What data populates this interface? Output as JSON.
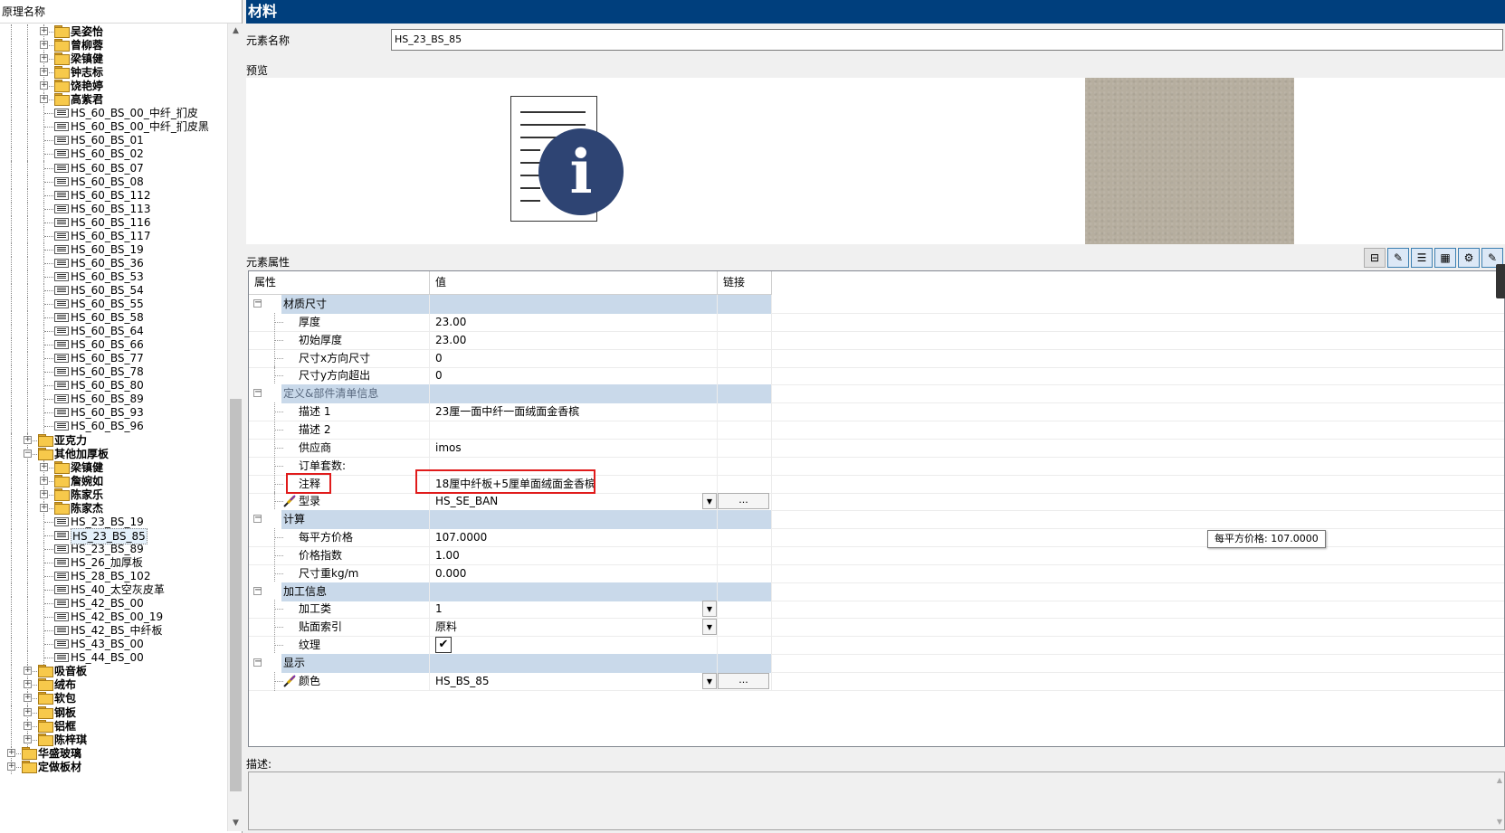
{
  "left_panel": {
    "header": "原理名称",
    "tree": [
      {
        "label": "吴姿怡",
        "type": "folder",
        "level": 2,
        "expanded": false
      },
      {
        "label": "曾柳蓉",
        "type": "folder",
        "level": 2,
        "expanded": false
      },
      {
        "label": "梁镇健",
        "type": "folder",
        "level": 2,
        "expanded": false
      },
      {
        "label": "钟志标",
        "type": "folder",
        "level": 2,
        "expanded": false
      },
      {
        "label": "饶艳婷",
        "type": "folder",
        "level": 2,
        "expanded": false
      },
      {
        "label": "高紫君",
        "type": "folder",
        "level": 2,
        "expanded": false
      },
      {
        "label": "HS_60_BS_00_中纤_扪皮",
        "type": "material",
        "level": 2
      },
      {
        "label": "HS_60_BS_00_中纤_扪皮黑",
        "type": "material",
        "level": 2
      },
      {
        "label": "HS_60_BS_01",
        "type": "material",
        "level": 2
      },
      {
        "label": "HS_60_BS_02",
        "type": "material",
        "level": 2
      },
      {
        "label": "HS_60_BS_07",
        "type": "material",
        "level": 2
      },
      {
        "label": "HS_60_BS_08",
        "type": "material",
        "level": 2
      },
      {
        "label": "HS_60_BS_112",
        "type": "material",
        "level": 2
      },
      {
        "label": "HS_60_BS_113",
        "type": "material",
        "level": 2
      },
      {
        "label": "HS_60_BS_116",
        "type": "material",
        "level": 2
      },
      {
        "label": "HS_60_BS_117",
        "type": "material",
        "level": 2
      },
      {
        "label": "HS_60_BS_19",
        "type": "material",
        "level": 2
      },
      {
        "label": "HS_60_BS_36",
        "type": "material",
        "level": 2
      },
      {
        "label": "HS_60_BS_53",
        "type": "material",
        "level": 2
      },
      {
        "label": "HS_60_BS_54",
        "type": "material",
        "level": 2
      },
      {
        "label": "HS_60_BS_55",
        "type": "material",
        "level": 2
      },
      {
        "label": "HS_60_BS_58",
        "type": "material",
        "level": 2
      },
      {
        "label": "HS_60_BS_64",
        "type": "material",
        "level": 2
      },
      {
        "label": "HS_60_BS_66",
        "type": "material",
        "level": 2
      },
      {
        "label": "HS_60_BS_77",
        "type": "material",
        "level": 2
      },
      {
        "label": "HS_60_BS_78",
        "type": "material",
        "level": 2
      },
      {
        "label": "HS_60_BS_80",
        "type": "material",
        "level": 2
      },
      {
        "label": "HS_60_BS_89",
        "type": "material",
        "level": 2
      },
      {
        "label": "HS_60_BS_93",
        "type": "material",
        "level": 2
      },
      {
        "label": "HS_60_BS_96",
        "type": "material",
        "level": 2
      },
      {
        "label": "亚克力",
        "type": "folder",
        "level": 1,
        "expanded": false
      },
      {
        "label": "其他加厚板",
        "type": "folder",
        "level": 1,
        "expanded": true
      },
      {
        "label": "梁镇健",
        "type": "folder",
        "level": 2,
        "expanded": false
      },
      {
        "label": "詹婉如",
        "type": "folder",
        "level": 2,
        "expanded": false
      },
      {
        "label": "陈家乐",
        "type": "folder",
        "level": 2,
        "expanded": false
      },
      {
        "label": "陈家杰",
        "type": "folder",
        "level": 2,
        "expanded": false
      },
      {
        "label": "HS_23_BS_19",
        "type": "material",
        "level": 2
      },
      {
        "label": "HS_23_BS_85",
        "type": "material",
        "level": 2,
        "selected": true
      },
      {
        "label": "HS_23_BS_89",
        "type": "material",
        "level": 2
      },
      {
        "label": "HS_26_加厚板",
        "type": "material",
        "level": 2
      },
      {
        "label": "HS_28_BS_102",
        "type": "material",
        "level": 2
      },
      {
        "label": "HS_40_太空灰皮革",
        "type": "material",
        "level": 2
      },
      {
        "label": "HS_42_BS_00",
        "type": "material",
        "level": 2
      },
      {
        "label": "HS_42_BS_00_19",
        "type": "material",
        "level": 2
      },
      {
        "label": "HS_42_BS_中纤板",
        "type": "material",
        "level": 2
      },
      {
        "label": "HS_43_BS_00",
        "type": "material",
        "level": 2
      },
      {
        "label": "HS_44_BS_00",
        "type": "material",
        "level": 2
      },
      {
        "label": "吸音板",
        "type": "folder",
        "level": 1,
        "expanded": false
      },
      {
        "label": "绒布",
        "type": "folder",
        "level": 1,
        "expanded": false
      },
      {
        "label": "软包",
        "type": "folder",
        "level": 1,
        "expanded": false
      },
      {
        "label": "钢板",
        "type": "folder",
        "level": 1,
        "expanded": false
      },
      {
        "label": "铝框",
        "type": "folder",
        "level": 1,
        "expanded": false
      },
      {
        "label": "陈梓琪",
        "type": "folder",
        "level": 1,
        "expanded": false
      },
      {
        "label": "华盛玻璃",
        "type": "folder",
        "level": 0,
        "expanded": false
      },
      {
        "label": "定做板材",
        "type": "folder",
        "level": 0,
        "expanded": false
      }
    ]
  },
  "right_panel": {
    "title": "材料",
    "element_name_label": "元素名称",
    "element_name_value": "HS_23_BS_85",
    "preview_label": "预览",
    "properties_label": "元素属性",
    "grid": {
      "headers": [
        "属性",
        "值",
        "链接"
      ],
      "rows": [
        {
          "kind": "category",
          "label": "材质尺寸"
        },
        {
          "kind": "prop",
          "label": "厚度",
          "value": "23.00"
        },
        {
          "kind": "prop",
          "label": "初始厚度",
          "value": "23.00"
        },
        {
          "kind": "prop",
          "label": "尺寸x方向尺寸",
          "value": "0"
        },
        {
          "kind": "prop",
          "label": "尺寸y方向超出",
          "value": "0"
        },
        {
          "kind": "category",
          "label": "定义&部件清单信息",
          "dim": true
        },
        {
          "kind": "prop",
          "label": "描述 1",
          "value": "23厘一面中纤一面绒面金香槟"
        },
        {
          "kind": "prop",
          "label": "描述 2",
          "value": ""
        },
        {
          "kind": "prop",
          "label": "供应商",
          "value": "imos"
        },
        {
          "kind": "prop",
          "label": "订单套数:",
          "value": ""
        },
        {
          "kind": "prop",
          "label": "注释",
          "value": "18厘中纤板+5厘单面绒面金香槟",
          "highlight": true
        },
        {
          "kind": "prop",
          "label": "型录",
          "value": "HS_SE_BAN",
          "dropdown": true,
          "ellipsis": true,
          "icon": "brush"
        },
        {
          "kind": "category",
          "label": "计算"
        },
        {
          "kind": "prop",
          "label": "每平方价格",
          "value": "107.0000"
        },
        {
          "kind": "prop",
          "label": "价格指数",
          "value": "1.00"
        },
        {
          "kind": "prop",
          "label": "尺寸重kg/m",
          "value": "0.000"
        },
        {
          "kind": "category",
          "label": "加工信息"
        },
        {
          "kind": "prop",
          "label": "加工类",
          "value": "1",
          "dropdown": true
        },
        {
          "kind": "prop",
          "label": "贴面索引",
          "value": "原料",
          "dropdown": true
        },
        {
          "kind": "prop",
          "label": "纹理",
          "value": "",
          "checkbox": true
        },
        {
          "kind": "category",
          "label": "显示"
        },
        {
          "kind": "prop",
          "label": "颜色",
          "value": "HS_BS_85",
          "dropdown": true,
          "ellipsis": true,
          "icon": "brush"
        }
      ],
      "ellipsis_label": "..."
    },
    "tooltip": "每平方价格: 107.0000",
    "description_label": "描述:",
    "toolbar": [
      {
        "name": "collapse-all-button",
        "icon": "minus-box-icon"
      },
      {
        "name": "color-tool-button",
        "icon": "brush-icon"
      },
      {
        "name": "list-view-button",
        "icon": "list-icon"
      },
      {
        "name": "calculator-button",
        "icon": "calculator-icon"
      },
      {
        "name": "settings-button",
        "icon": "gear-icon"
      },
      {
        "name": "paint-button",
        "icon": "brush-icon"
      }
    ]
  },
  "colors": {
    "title_bar": "#003f7d",
    "category_row": "#c9d9ea",
    "highlight_box": "#e01b1b",
    "info_circle": "#2e4473",
    "texture": "#b6ae9f"
  }
}
